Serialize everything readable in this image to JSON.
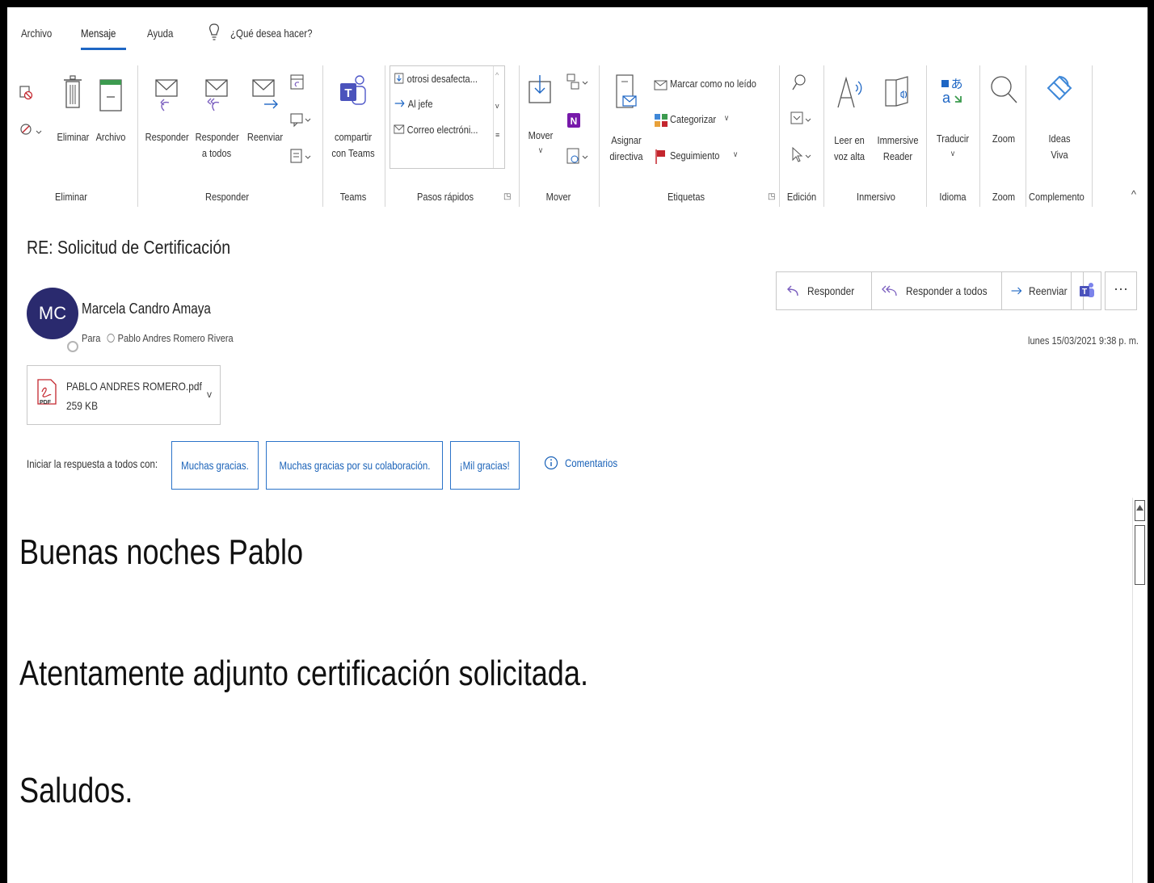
{
  "menu": {
    "tabs": [
      "Archivo",
      "Mensaje",
      "Ayuda"
    ],
    "search_placeholder": "¿Qué desea hacer?"
  },
  "ribbon": {
    "groups": {
      "eliminar": "Eliminar",
      "responder": "Responder",
      "teams": "Teams",
      "pasos_rapidos": "Pasos rápidos",
      "mover": "Mover",
      "etiquetas": "Etiquetas",
      "edicion": "Edición",
      "inmersivo": "Inmersivo",
      "idioma": "Idioma",
      "zoom": "Zoom",
      "complemento": "Complemento"
    },
    "buttons": {
      "eliminar": "Eliminar",
      "archivo": "Archivo",
      "responder": "Responder",
      "responder_todos_1": "Responder",
      "responder_todos_2": "a todos",
      "reenviar": "Reenviar",
      "compartir_1": "compartir",
      "compartir_2": "con Teams",
      "mover": "Mover",
      "asignar_1": "Asignar",
      "asignar_2": "directiva",
      "marcar": "Marcar como no leído",
      "categorizar": "Categorizar",
      "seguimiento": "Seguimiento",
      "leer_1": "Leer en",
      "leer_2": "voz alta",
      "immersive_1": "Immersive",
      "immersive_2": "Reader",
      "traducir": "Traducir",
      "zoom": "Zoom",
      "ideas_1": "Ideas",
      "ideas_2": "Viva"
    },
    "quick_steps": [
      "otrosi desafecta...",
      "Al jefe",
      "Correo electróni..."
    ]
  },
  "message": {
    "subject": "RE: Solicitud de Certificación",
    "avatar_initials": "MC",
    "sender": "Marcela Candro Amaya",
    "to_label": "Para",
    "recipient": "Pablo Andres Romero Rivera",
    "date": "lunes 15/03/2021 9:38 p. m.",
    "actions": {
      "reply": "Responder",
      "reply_all": "Responder a todos",
      "forward": "Reenviar",
      "more": "···"
    },
    "attachment": {
      "name": "PABLO ANDRES ROMERO.pdf",
      "size": "259 KB",
      "type_badge": "PDF"
    },
    "quick_reply": {
      "label": "Iniciar la respuesta a todos con:",
      "options": [
        "Muchas gracias.",
        "Muchas gracias por su colaboración.",
        "¡Mil gracias!"
      ],
      "comments": "Comentarios"
    },
    "body": [
      "Buenas noches Pablo",
      "Atentamente adjunto certificación solicitada.",
      "Saludos."
    ]
  },
  "colors": {
    "accent": "#1e66c4",
    "link": "#1a62b8",
    "avatar_bg": "#2a2a6e",
    "teams_purple": "#5059c9",
    "onenote_purple": "#7719aa",
    "follow_up_red": "#c4262e"
  }
}
